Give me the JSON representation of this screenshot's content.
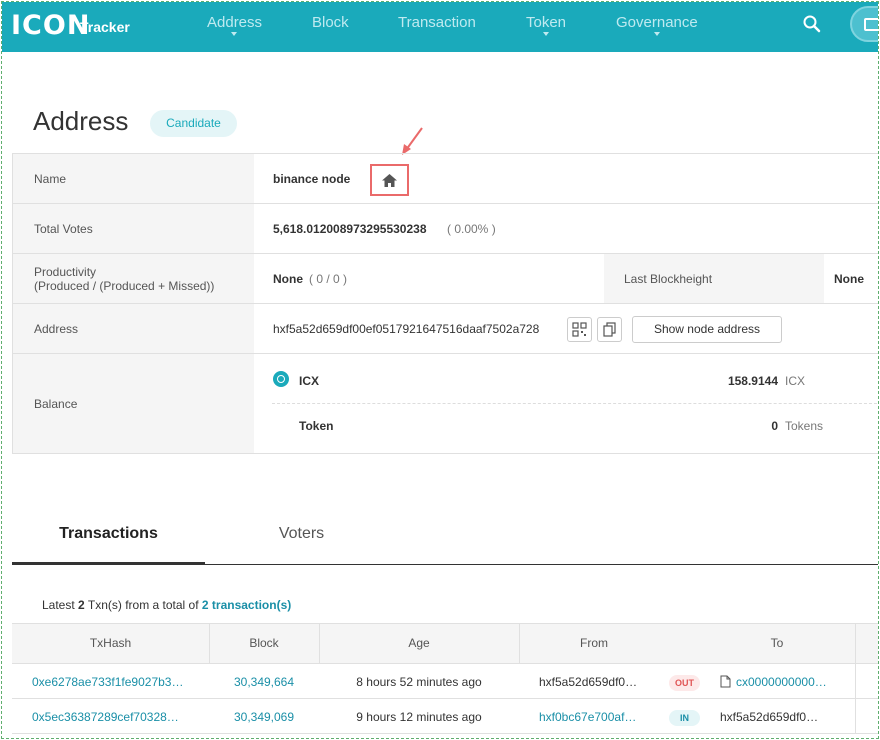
{
  "header": {
    "logo": "ICON",
    "logo_sub": "Tracker",
    "nav": [
      {
        "label": "Address",
        "has_dropdown": true
      },
      {
        "label": "Block",
        "has_dropdown": false
      },
      {
        "label": "Transaction",
        "has_dropdown": false
      },
      {
        "label": "Token",
        "has_dropdown": true
      },
      {
        "label": "Governance",
        "has_dropdown": true
      }
    ],
    "icons": [
      "search-icon",
      "wallet-icon"
    ],
    "brand_color": "#1aaabb"
  },
  "page": {
    "title": "Address",
    "badge": "Candidate"
  },
  "info": {
    "name_label": "Name",
    "name_value": "binance node",
    "votes_label": "Total Votes",
    "votes_value": "5,618.012008973295530238",
    "votes_pct": "( 0.00% )",
    "productivity_label_1": "Productivity",
    "productivity_label_2": "(Produced / (Produced + Missed))",
    "productivity_value": "None",
    "productivity_ratio": "( 0 / 0 )",
    "last_block_label": "Last Blockheight",
    "last_block_value": "None",
    "address_label": "Address",
    "address_value": "hxf5a52d659df00ef0517921647516daaf7502a728",
    "show_node_button": "Show node address",
    "balance_label": "Balance",
    "icx_label": "ICX",
    "icx_amount": "158.9144",
    "icx_unit": "ICX",
    "token_label": "Token",
    "token_amount": "0",
    "token_unit": "Tokens"
  },
  "tabs": {
    "active": "Transactions",
    "other": "Voters"
  },
  "latest": {
    "prefix": "Latest",
    "count": "2",
    "middle": "Txn(s) from a total of",
    "total_link": "2 transaction(s)"
  },
  "tx_table": {
    "headers": [
      "TxHash",
      "Block",
      "Age",
      "From",
      "To"
    ],
    "rows": [
      {
        "hash": "0xe6278ae733f1fe9027b3…",
        "block": "30,349,664",
        "age": "8 hours 52 minutes ago",
        "from": "hxf5a52d659df0…",
        "direction": "OUT",
        "to": "cx0000000000…"
      },
      {
        "hash": "0x5ec36387289cef70328…",
        "block": "30,349,069",
        "age": "9 hours 12 minutes ago",
        "from": "hxf0bc67e700af…",
        "direction": "IN",
        "to": "hxf5a52d659df0…"
      }
    ]
  }
}
